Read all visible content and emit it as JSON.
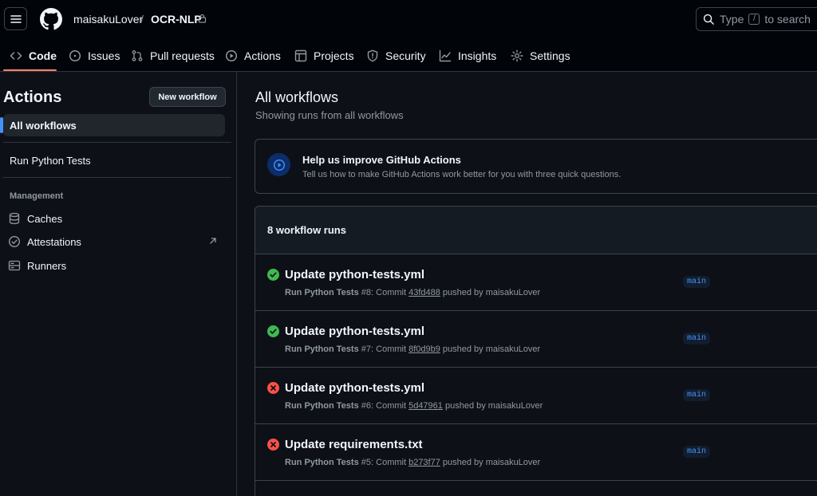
{
  "header": {
    "owner": "maisakuLover",
    "separator": "/",
    "repo": "OCR-NLP",
    "search_prefix": "Type",
    "search_key": "/",
    "search_suffix": "to search"
  },
  "tabs": [
    {
      "label": "Code",
      "icon": "code-icon"
    },
    {
      "label": "Issues",
      "icon": "issue-icon"
    },
    {
      "label": "Pull requests",
      "icon": "pull-request-icon"
    },
    {
      "label": "Actions",
      "icon": "play-icon"
    },
    {
      "label": "Projects",
      "icon": "table-icon"
    },
    {
      "label": "Security",
      "icon": "shield-icon"
    },
    {
      "label": "Insights",
      "icon": "graph-icon"
    },
    {
      "label": "Settings",
      "icon": "gear-icon"
    }
  ],
  "sidebar": {
    "title": "Actions",
    "new_workflow": "New workflow",
    "all_workflows": "All workflows",
    "workflow": "Run Python Tests",
    "management_heading": "Management",
    "management": [
      {
        "label": "Caches",
        "icon": "database-icon"
      },
      {
        "label": "Attestations",
        "icon": "verified-icon"
      },
      {
        "label": "Runners",
        "icon": "server-icon"
      }
    ]
  },
  "main": {
    "title": "All workflows",
    "subtitle": "Showing runs from all workflows",
    "banner_title": "Help us improve GitHub Actions",
    "banner_text": "Tell us how to make GitHub Actions work better for you with three quick questions.",
    "runs_count": "8 workflow runs"
  },
  "runs": [
    {
      "status": "success",
      "title": "Update python-tests.yml",
      "workflow": "Run Python Tests",
      "number": "#8",
      "commit_label": ": Commit",
      "sha": "43fd488",
      "pushed": "pushed by maisakuLover",
      "branch": "main"
    },
    {
      "status": "success",
      "title": "Update python-tests.yml",
      "workflow": "Run Python Tests",
      "number": "#7",
      "commit_label": ": Commit",
      "sha": "8f0d9b9",
      "pushed": "pushed by maisakuLover",
      "branch": "main"
    },
    {
      "status": "failure",
      "title": "Update python-tests.yml",
      "workflow": "Run Python Tests",
      "number": "#6",
      "commit_label": ": Commit",
      "sha": "5d47961",
      "pushed": "pushed by maisakuLover",
      "branch": "main"
    },
    {
      "status": "failure",
      "title": "Update requirements.txt",
      "workflow": "Run Python Tests",
      "number": "#5",
      "commit_label": ": Commit",
      "sha": "b273f77",
      "pushed": "pushed by maisakuLover",
      "branch": "main"
    }
  ],
  "colors": {
    "success": "#3fb950",
    "failure": "#f85149",
    "accent": "#f78166",
    "link": "#4493f8"
  }
}
